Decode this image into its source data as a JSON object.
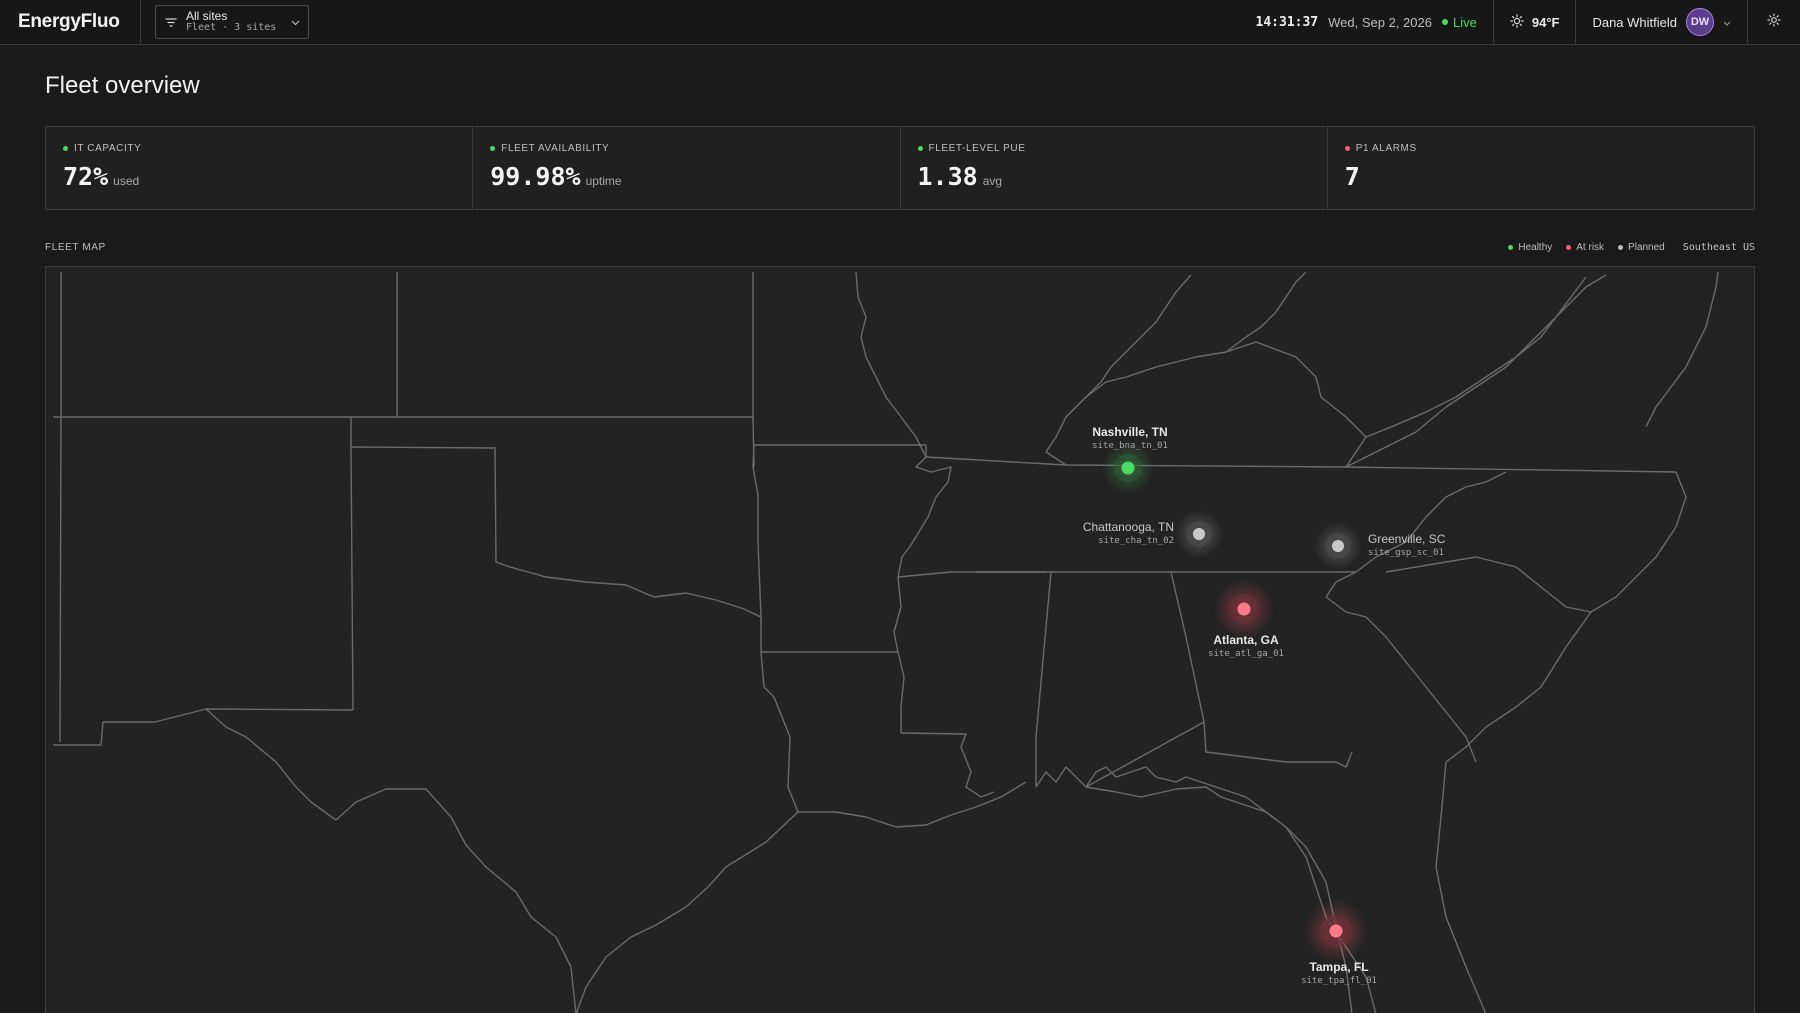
{
  "app": {
    "brand": "EnergyFluo"
  },
  "site_switcher": {
    "title": "All sites",
    "subtitle": "Fleet · 3 sites",
    "icon": "filter-icon",
    "chevron": "chevron-down-icon"
  },
  "status": {
    "time": "14:31:37",
    "date": "Wed, Sep 2, 2026",
    "live_label": "Live",
    "live_color": "#4cd964"
  },
  "weather": {
    "icon": "sun-icon",
    "temp": "94°F"
  },
  "user": {
    "name": "Dana Whitfield",
    "initials": "DW"
  },
  "page": {
    "title": "Fleet overview"
  },
  "kpis": [
    {
      "label": "IT CAPACITY",
      "value": "72%",
      "unit": "used",
      "status_color": "#4cd964"
    },
    {
      "label": "FLEET AVAILABILITY",
      "value": "99.98%",
      "unit": "uptime",
      "status_color": "#4cd964"
    },
    {
      "label": "FLEET-LEVEL PUE",
      "value": "1.38",
      "unit": "avg",
      "status_color": "#4cd964"
    },
    {
      "label": "P1 ALARMS",
      "value": "7",
      "unit": "",
      "status_color": "#ff5a6e"
    }
  ],
  "map": {
    "title": "FLEET MAP",
    "region": "Southeast US",
    "legend": [
      {
        "label": "Healthy",
        "color": "#4cd964"
      },
      {
        "label": "At risk",
        "color": "#ff5a6e"
      },
      {
        "label": "Planned",
        "color": "#bdbdbd"
      }
    ],
    "sites": [
      {
        "name": "Nashville, TN",
        "id": "site_bna_tn_01",
        "status": "Healthy"
      },
      {
        "name": "Chattanooga, TN",
        "id": "site_cha_tn_02",
        "status": "Planned"
      },
      {
        "name": "Greenville, SC",
        "id": "site_gsp_sc_01",
        "status": "Planned"
      },
      {
        "name": "Atlanta, GA",
        "id": "site_atl_ga_01",
        "status": "At risk"
      },
      {
        "name": "Tampa, FL",
        "id": "site_tpa_fl_01",
        "status": "At risk"
      }
    ]
  }
}
